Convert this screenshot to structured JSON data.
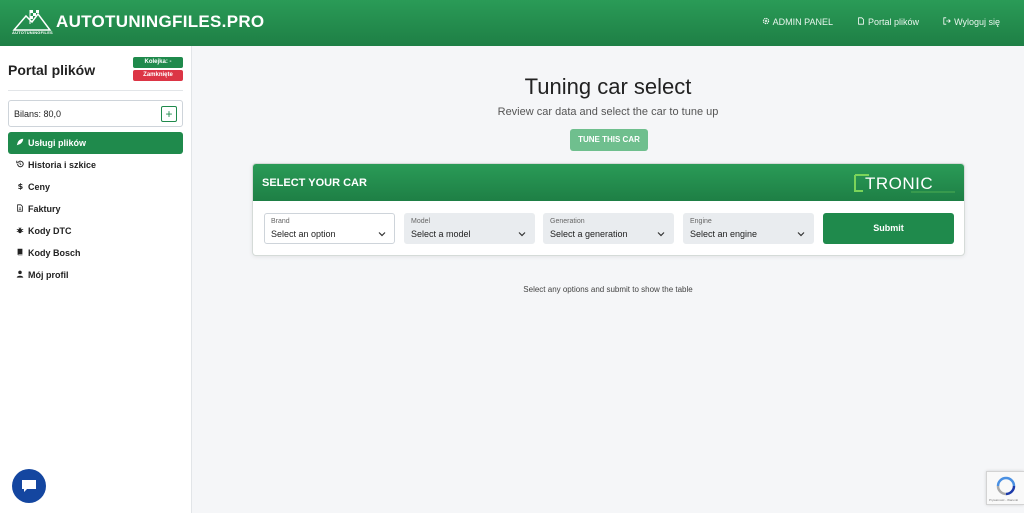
{
  "header": {
    "title": "AUTOTUNINGFILES.PRO",
    "logo_sub": "AUTOTUNINGFILES",
    "nav": [
      {
        "label": "ADMIN PANEL",
        "icon": "gear-icon"
      },
      {
        "label": "Portal plików",
        "icon": "document-icon"
      },
      {
        "label": "Wyloguj się",
        "icon": "logout-icon"
      }
    ]
  },
  "sidebar": {
    "title": "Portal plików",
    "queue_badge": "Kolejka: -",
    "status_badge": "Zamknięte",
    "balance_label": "Bilans: 80,0",
    "balance_add": "+",
    "items": [
      {
        "label": "Usługi plików",
        "icon": "rocket-icon",
        "active": true
      },
      {
        "label": "Historia i szkice",
        "icon": "history-icon"
      },
      {
        "label": "Ceny",
        "icon": "dollar-icon"
      },
      {
        "label": "Faktury",
        "icon": "invoice-icon"
      },
      {
        "label": "Kody DTC",
        "icon": "bug-icon"
      },
      {
        "label": "Kody Bosch",
        "icon": "book-icon"
      },
      {
        "label": "Mój profil",
        "icon": "user-icon"
      }
    ]
  },
  "main": {
    "title": "Tuning car select",
    "subtitle": "Review car data and select the car to tune up",
    "tune_button": "TUNE THIS CAR",
    "card_title": "SELECT YOUR CAR",
    "brand_logo_text": "TRONIC",
    "fields": [
      {
        "label": "Brand",
        "value": "Select an option",
        "enabled": true
      },
      {
        "label": "Model",
        "value": "Select a model",
        "enabled": false
      },
      {
        "label": "Generation",
        "value": "Select a generation",
        "enabled": false
      },
      {
        "label": "Engine",
        "value": "Select an engine",
        "enabled": false
      }
    ],
    "submit": "Submit",
    "hint": "Select any options and submit to show the table"
  },
  "colors": {
    "primary": "#1f8a4c",
    "danger": "#dc3545",
    "chat": "#1446a0"
  },
  "recaptcha_text": "Prywatność - Warunki"
}
